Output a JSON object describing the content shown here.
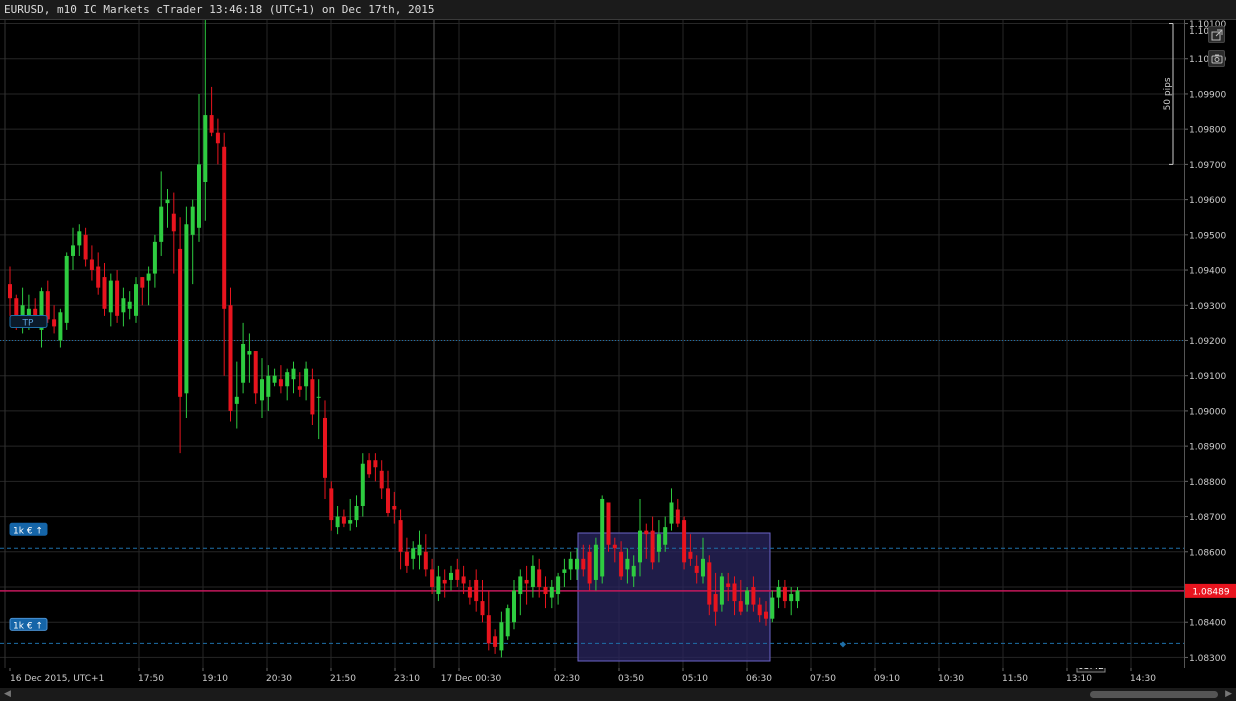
{
  "window": {
    "title": "EURUSD, m10 IC Markets cTrader 13:46:18 (UTC+1) on Dec 17th, 2015"
  },
  "price_axis": {
    "labels": [
      "1.10100",
      "1.10000",
      "1.09900",
      "1.09800",
      "1.09700",
      "1.09600",
      "1.09500",
      "1.09400",
      "1.09300",
      "1.09200",
      "1.09100",
      "1.09000",
      "1.08900",
      "1.08800",
      "1.08700",
      "1.08600",
      "1.08400",
      "1.08300"
    ],
    "top_label": "1.10",
    "current_price": "1.08489",
    "scale_bar_label": "50 pips"
  },
  "time_axis": {
    "labels": [
      "16 Dec 2015, UTC+1",
      "17:50",
      "19:10",
      "20:30",
      "21:50",
      "23:10",
      "17 Dec 00:30",
      "02:30",
      "03:50",
      "05:10",
      "06:30",
      "07:50",
      "09:10",
      "10:30",
      "11:50",
      "13:10",
      "14:30"
    ],
    "cursor_time": "03:42"
  },
  "order_lines": {
    "tp_label": "TP",
    "buy_label": "1k € ↑",
    "sell_label": "1k € ↑"
  },
  "toolbar": {
    "popout_icon": "popout-icon",
    "snapshot_icon": "camera-icon"
  },
  "colors": {
    "bull": "#2ecc40",
    "bear": "#e8141e",
    "grid": "#262626",
    "current_price_line": "#c2185b",
    "tp_line": "#1e6fa8",
    "selection_fill": "#2a2660",
    "selection_border": "#6b63c8"
  },
  "chart_data": {
    "type": "candlestick",
    "symbol": "EURUSD",
    "timeframe": "m10",
    "ylim": [
      1.0827,
      1.1011
    ],
    "tp_price": 1.092,
    "order_price_1": 1.0861,
    "order_price_2": 1.0834,
    "current_price": 1.08489,
    "candles": [
      [
        1.0936,
        1.0941,
        1.0927,
        1.0932
      ],
      [
        1.0932,
        1.0933,
        1.0923,
        1.0927
      ],
      [
        1.0925,
        1.0935,
        1.0922,
        1.093
      ],
      [
        1.0927,
        1.0933,
        1.0923,
        1.0929
      ],
      [
        1.0929,
        1.0932,
        1.0924,
        1.0926
      ],
      [
        1.0923,
        1.0935,
        1.0918,
        1.0934
      ],
      [
        1.0934,
        1.0937,
        1.0925,
        1.0926
      ],
      [
        1.0926,
        1.093,
        1.0922,
        1.0924
      ],
      [
        1.092,
        1.0929,
        1.0918,
        1.0928
      ],
      [
        1.0925,
        1.0945,
        1.0923,
        1.0944
      ],
      [
        1.0944,
        1.0952,
        1.094,
        1.0947
      ],
      [
        1.0947,
        1.0953,
        1.0944,
        1.0951
      ],
      [
        1.095,
        1.0952,
        1.0941,
        1.0943
      ],
      [
        1.0943,
        1.0947,
        1.0937,
        1.094
      ],
      [
        1.0941,
        1.0945,
        1.0933,
        1.0935
      ],
      [
        1.0938,
        1.0942,
        1.0927,
        1.0929
      ],
      [
        1.0928,
        1.0939,
        1.0924,
        1.0937
      ],
      [
        1.0937,
        1.094,
        1.0925,
        1.0927
      ],
      [
        1.0928,
        1.0935,
        1.0924,
        1.0932
      ],
      [
        1.0929,
        1.0934,
        1.0926,
        1.0931
      ],
      [
        1.0927,
        1.0938,
        1.0925,
        1.0936
      ],
      [
        1.0938,
        1.0938,
        1.093,
        1.0935
      ],
      [
        1.0937,
        1.0941,
        1.093,
        1.0939
      ],
      [
        1.0939,
        1.095,
        1.0935,
        1.0948
      ],
      [
        1.0948,
        1.0968,
        1.0944,
        1.0958
      ],
      [
        1.0959,
        1.0963,
        1.0952,
        1.096
      ],
      [
        1.0956,
        1.0962,
        1.0939,
        1.0951
      ],
      [
        1.0946,
        1.0955,
        1.0888,
        1.0904
      ],
      [
        1.0905,
        1.0958,
        1.0898,
        1.0953
      ],
      [
        1.095,
        1.096,
        1.0936,
        1.0958
      ],
      [
        1.0952,
        1.099,
        1.0948,
        1.097
      ],
      [
        1.0965,
        1.1011,
        1.0954,
        1.0984
      ],
      [
        1.0984,
        1.0992,
        1.0978,
        1.0979
      ],
      [
        1.0979,
        1.0983,
        1.097,
        1.0976
      ],
      [
        1.0975,
        1.0979,
        1.091,
        1.0929
      ],
      [
        1.093,
        1.0935,
        1.0897,
        1.09
      ],
      [
        1.0902,
        1.0914,
        1.0895,
        1.0904
      ],
      [
        1.0908,
        1.0925,
        1.0905,
        1.0919
      ],
      [
        1.0916,
        1.0922,
        1.0908,
        1.0917
      ],
      [
        1.0917,
        1.0917,
        1.0902,
        1.0905
      ],
      [
        1.0903,
        1.0915,
        1.0898,
        1.0909
      ],
      [
        1.0904,
        1.0913,
        1.09,
        1.091
      ],
      [
        1.0908,
        1.0912,
        1.0907,
        1.091
      ],
      [
        1.0909,
        1.0913,
        1.0905,
        1.0907
      ],
      [
        1.0907,
        1.0912,
        1.0903,
        1.0911
      ],
      [
        1.0909,
        1.0914,
        1.0905,
        1.0912
      ],
      [
        1.0907,
        1.0911,
        1.0904,
        1.0906
      ],
      [
        1.0907,
        1.0914,
        1.0903,
        1.0912
      ],
      [
        1.0909,
        1.0912,
        1.0896,
        1.0899
      ],
      [
        1.0904,
        1.0909,
        1.0892,
        1.0904
      ],
      [
        1.0898,
        1.0903,
        1.0875,
        1.0881
      ],
      [
        1.0878,
        1.088,
        1.0866,
        1.0869
      ],
      [
        1.0867,
        1.0873,
        1.0865,
        1.087
      ],
      [
        1.087,
        1.0872,
        1.0867,
        1.0868
      ],
      [
        1.0868,
        1.0875,
        1.0866,
        1.0869
      ],
      [
        1.0869,
        1.0876,
        1.0867,
        1.0873
      ],
      [
        1.0873,
        1.0888,
        1.087,
        1.0885
      ],
      [
        1.0886,
        1.0888,
        1.0881,
        1.0882
      ],
      [
        1.0886,
        1.0888,
        1.088,
        1.0884
      ],
      [
        1.0883,
        1.0886,
        1.0875,
        1.0878
      ],
      [
        1.0878,
        1.0883,
        1.087,
        1.0871
      ],
      [
        1.0873,
        1.0877,
        1.0868,
        1.0872
      ],
      [
        1.0869,
        1.0872,
        1.0855,
        1.086
      ],
      [
        1.086,
        1.0864,
        1.0854,
        1.0856
      ],
      [
        1.0858,
        1.0863,
        1.0855,
        1.0861
      ],
      [
        1.0859,
        1.0866,
        1.0855,
        1.0862
      ],
      [
        1.086,
        1.0865,
        1.0853,
        1.0855
      ],
      [
        1.0855,
        1.0858,
        1.0848,
        1.085
      ],
      [
        1.0848,
        1.0856,
        1.0846,
        1.0853
      ],
      [
        1.0852,
        1.0855,
        1.0847,
        1.0851
      ],
      [
        1.0852,
        1.0856,
        1.0849,
        1.0854
      ],
      [
        1.0855,
        1.0858,
        1.085,
        1.0852
      ],
      [
        1.0853,
        1.0856,
        1.0848,
        1.0851
      ],
      [
        1.085,
        1.0852,
        1.0845,
        1.0847
      ],
      [
        1.0852,
        1.0855,
        1.0843,
        1.0846
      ],
      [
        1.0846,
        1.0852,
        1.084,
        1.0842
      ],
      [
        1.0842,
        1.0849,
        1.0832,
        1.0834
      ],
      [
        1.0836,
        1.0838,
        1.0831,
        1.0833
      ],
      [
        1.0832,
        1.0843,
        1.083,
        1.084
      ],
      [
        1.0836,
        1.0845,
        1.0835,
        1.0844
      ],
      [
        1.084,
        1.0852,
        1.0838,
        1.0849
      ],
      [
        1.0848,
        1.0855,
        1.0842,
        1.0853
      ],
      [
        1.0852,
        1.0856,
        1.0845,
        1.0851
      ],
      [
        1.085,
        1.0859,
        1.0847,
        1.0856
      ],
      [
        1.0855,
        1.0858,
        1.0847,
        1.085
      ],
      [
        1.085,
        1.0853,
        1.0844,
        1.0848
      ],
      [
        1.0847,
        1.0852,
        1.0844,
        1.085
      ],
      [
        1.0848,
        1.0854,
        1.0845,
        1.0853
      ],
      [
        1.0854,
        1.0858,
        1.085,
        1.0855
      ],
      [
        1.0855,
        1.086,
        1.0852,
        1.0858
      ],
      [
        1.0855,
        1.0861,
        1.0852,
        1.0858
      ],
      [
        1.0858,
        1.0862,
        1.0853,
        1.0855
      ],
      [
        1.086,
        1.0862,
        1.0849,
        1.0851
      ],
      [
        1.0852,
        1.0864,
        1.0849,
        1.0862
      ],
      [
        1.0853,
        1.0876,
        1.0851,
        1.0875
      ],
      [
        1.0874,
        1.0874,
        1.086,
        1.0862
      ],
      [
        1.0862,
        1.0864,
        1.0857,
        1.0861
      ],
      [
        1.086,
        1.0863,
        1.0852,
        1.0853
      ],
      [
        1.0855,
        1.0861,
        1.0851,
        1.0858
      ],
      [
        1.0853,
        1.0859,
        1.085,
        1.0856
      ],
      [
        1.0857,
        1.0875,
        1.0853,
        1.0866
      ],
      [
        1.0866,
        1.0868,
        1.0858,
        1.0865
      ],
      [
        1.0866,
        1.087,
        1.0855,
        1.0857
      ],
      [
        1.086,
        1.0869,
        1.0857,
        1.0865
      ],
      [
        1.0862,
        1.087,
        1.086,
        1.0867
      ],
      [
        1.0868,
        1.0878,
        1.0866,
        1.0874
      ],
      [
        1.0872,
        1.0875,
        1.0867,
        1.0868
      ],
      [
        1.0869,
        1.087,
        1.0855,
        1.0857
      ],
      [
        1.086,
        1.0865,
        1.0856,
        1.0858
      ],
      [
        1.0856,
        1.0859,
        1.0851,
        1.0854
      ],
      [
        1.0853,
        1.0864,
        1.0851,
        1.0858
      ],
      [
        1.0857,
        1.0859,
        1.0842,
        1.0845
      ],
      [
        1.0848,
        1.0854,
        1.0839,
        1.0843
      ],
      [
        1.0845,
        1.0854,
        1.0843,
        1.0853
      ],
      [
        1.0851,
        1.0854,
        1.0846,
        1.085
      ],
      [
        1.0851,
        1.0853,
        1.0842,
        1.0846
      ],
      [
        1.0846,
        1.0852,
        1.0842,
        1.0843
      ],
      [
        1.0845,
        1.085,
        1.0843,
        1.0849
      ],
      [
        1.085,
        1.0853,
        1.0843,
        1.0845
      ],
      [
        1.0845,
        1.0847,
        1.084,
        1.0842
      ],
      [
        1.0843,
        1.0846,
        1.0839,
        1.0841
      ],
      [
        1.0841,
        1.0849,
        1.084,
        1.0847
      ],
      [
        1.0847,
        1.0852,
        1.0844,
        1.085
      ],
      [
        1.085,
        1.0852,
        1.0844,
        1.0846
      ],
      [
        1.0846,
        1.085,
        1.0842,
        1.0848
      ],
      [
        1.0846,
        1.085,
        1.0844,
        1.0849
      ]
    ]
  }
}
